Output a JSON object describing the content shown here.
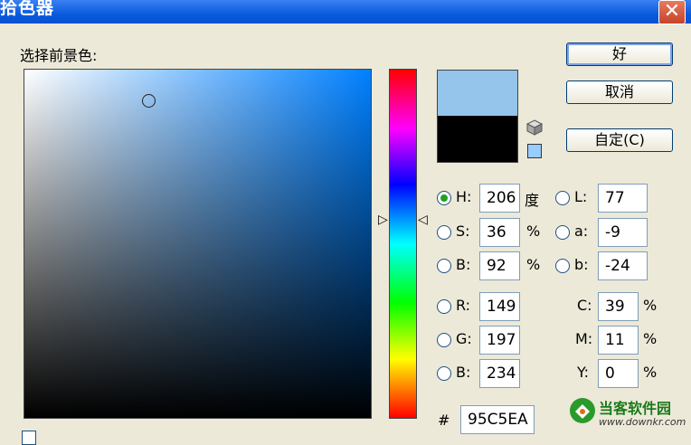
{
  "window": {
    "title": "拾色器",
    "close_glyph": "✕"
  },
  "picker": {
    "label": "选择前景色:",
    "field_hue_color": "#0080ff",
    "new_color": "#95C5EA",
    "current_color": "#000000",
    "hue_arrow_left": "▷",
    "hue_arrow_right": "◁",
    "gamut_icon": "cube-icon",
    "websafe_icon": "swatch-icon",
    "websafe_color": "#99ccff"
  },
  "buttons": {
    "ok": "好",
    "cancel": "取消",
    "custom": "自定(C)"
  },
  "hsb": [
    {
      "label": "H:",
      "value": "206",
      "unit": "度",
      "checked": true
    },
    {
      "label": "S:",
      "value": "36",
      "unit": "%",
      "checked": false
    },
    {
      "label": "B:",
      "value": "92",
      "unit": "%",
      "checked": false
    }
  ],
  "lab": [
    {
      "label": "L:",
      "value": "77"
    },
    {
      "label": "a:",
      "value": "-9"
    },
    {
      "label": "b:",
      "value": "-24"
    }
  ],
  "rgb": [
    {
      "label": "R:",
      "value": "149"
    },
    {
      "label": "G:",
      "value": "197"
    },
    {
      "label": "B:",
      "value": "234"
    }
  ],
  "cmyk": [
    {
      "label": "C:",
      "value": "39",
      "unit": "%"
    },
    {
      "label": "M:",
      "value": "11",
      "unit": "%"
    },
    {
      "label": "Y:",
      "value": "0",
      "unit": "%"
    }
  ],
  "hex": {
    "label": "#",
    "value": "95C5EA"
  },
  "watermark": {
    "name": "当客软件园",
    "url": "www.downkr.com"
  }
}
